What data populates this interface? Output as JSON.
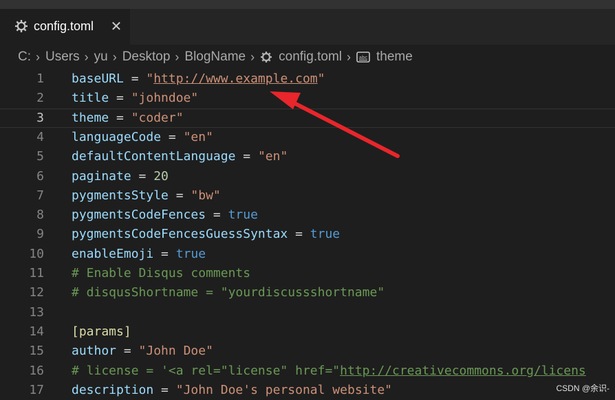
{
  "tab": {
    "icon": "gear-icon",
    "label": "config.toml",
    "close_glyph": "✕"
  },
  "breadcrumb": [
    {
      "label": "C:"
    },
    {
      "label": "Users"
    },
    {
      "label": "yu"
    },
    {
      "label": "Desktop"
    },
    {
      "label": "BlogName"
    },
    {
      "label": "config.toml",
      "icon": "gear-icon"
    },
    {
      "label": "theme",
      "icon": "string-symbol-icon"
    }
  ],
  "editor": {
    "current_line": 3,
    "lines": [
      {
        "n": "1",
        "tokens": [
          [
            "key",
            "baseURL"
          ],
          [
            "op",
            " = "
          ],
          [
            "str",
            "\""
          ],
          [
            "strlink",
            "http://www.example.com"
          ],
          [
            "str",
            "\""
          ]
        ]
      },
      {
        "n": "2",
        "tokens": [
          [
            "key",
            "title"
          ],
          [
            "op",
            " = "
          ],
          [
            "str",
            "\"johndoe\""
          ]
        ]
      },
      {
        "n": "3",
        "tokens": [
          [
            "key",
            "theme"
          ],
          [
            "op",
            " = "
          ],
          [
            "str",
            "\"coder\""
          ]
        ]
      },
      {
        "n": "4",
        "tokens": [
          [
            "key",
            "languageCode"
          ],
          [
            "op",
            " = "
          ],
          [
            "str",
            "\"en\""
          ]
        ]
      },
      {
        "n": "5",
        "tokens": [
          [
            "key",
            "defaultContentLanguage"
          ],
          [
            "op",
            " = "
          ],
          [
            "str",
            "\"en\""
          ]
        ]
      },
      {
        "n": "6",
        "tokens": [
          [
            "key",
            "paginate"
          ],
          [
            "op",
            " = "
          ],
          [
            "num",
            "20"
          ]
        ]
      },
      {
        "n": "7",
        "tokens": [
          [
            "key",
            "pygmentsStyle"
          ],
          [
            "op",
            " = "
          ],
          [
            "str",
            "\"bw\""
          ]
        ]
      },
      {
        "n": "8",
        "tokens": [
          [
            "key",
            "pygmentsCodeFences"
          ],
          [
            "op",
            " = "
          ],
          [
            "bool",
            "true"
          ]
        ]
      },
      {
        "n": "9",
        "tokens": [
          [
            "key",
            "pygmentsCodeFencesGuessSyntax"
          ],
          [
            "op",
            " = "
          ],
          [
            "bool",
            "true"
          ]
        ]
      },
      {
        "n": "10",
        "tokens": [
          [
            "key",
            "enableEmoji"
          ],
          [
            "op",
            " = "
          ],
          [
            "bool",
            "true"
          ]
        ]
      },
      {
        "n": "11",
        "tokens": [
          [
            "cmt",
            "# Enable Disqus comments"
          ]
        ]
      },
      {
        "n": "12",
        "tokens": [
          [
            "cmt",
            "# disqusShortname = \"yourdiscussshortname\""
          ]
        ]
      },
      {
        "n": "13",
        "tokens": []
      },
      {
        "n": "14",
        "tokens": [
          [
            "sect",
            "[params]"
          ]
        ]
      },
      {
        "n": "15",
        "tokens": [
          [
            "key",
            "author"
          ],
          [
            "op",
            " = "
          ],
          [
            "str",
            "\"John Doe\""
          ]
        ]
      },
      {
        "n": "16",
        "tokens": [
          [
            "cmt",
            "# license = '<a rel=\"license\" href=\""
          ],
          [
            "cmtlink",
            "http://creativecommons.org/licens"
          ]
        ]
      },
      {
        "n": "17",
        "tokens": [
          [
            "key",
            "description"
          ],
          [
            "op",
            " = "
          ],
          [
            "str",
            "\"John Doe's personal website\""
          ]
        ]
      }
    ]
  },
  "watermark": "CSDN @余识-",
  "colors": {
    "arrow": "#e8262b",
    "string": "#ce9178",
    "key": "#9cdcfe",
    "bool": "#569cd6",
    "comment": "#6a9955"
  }
}
